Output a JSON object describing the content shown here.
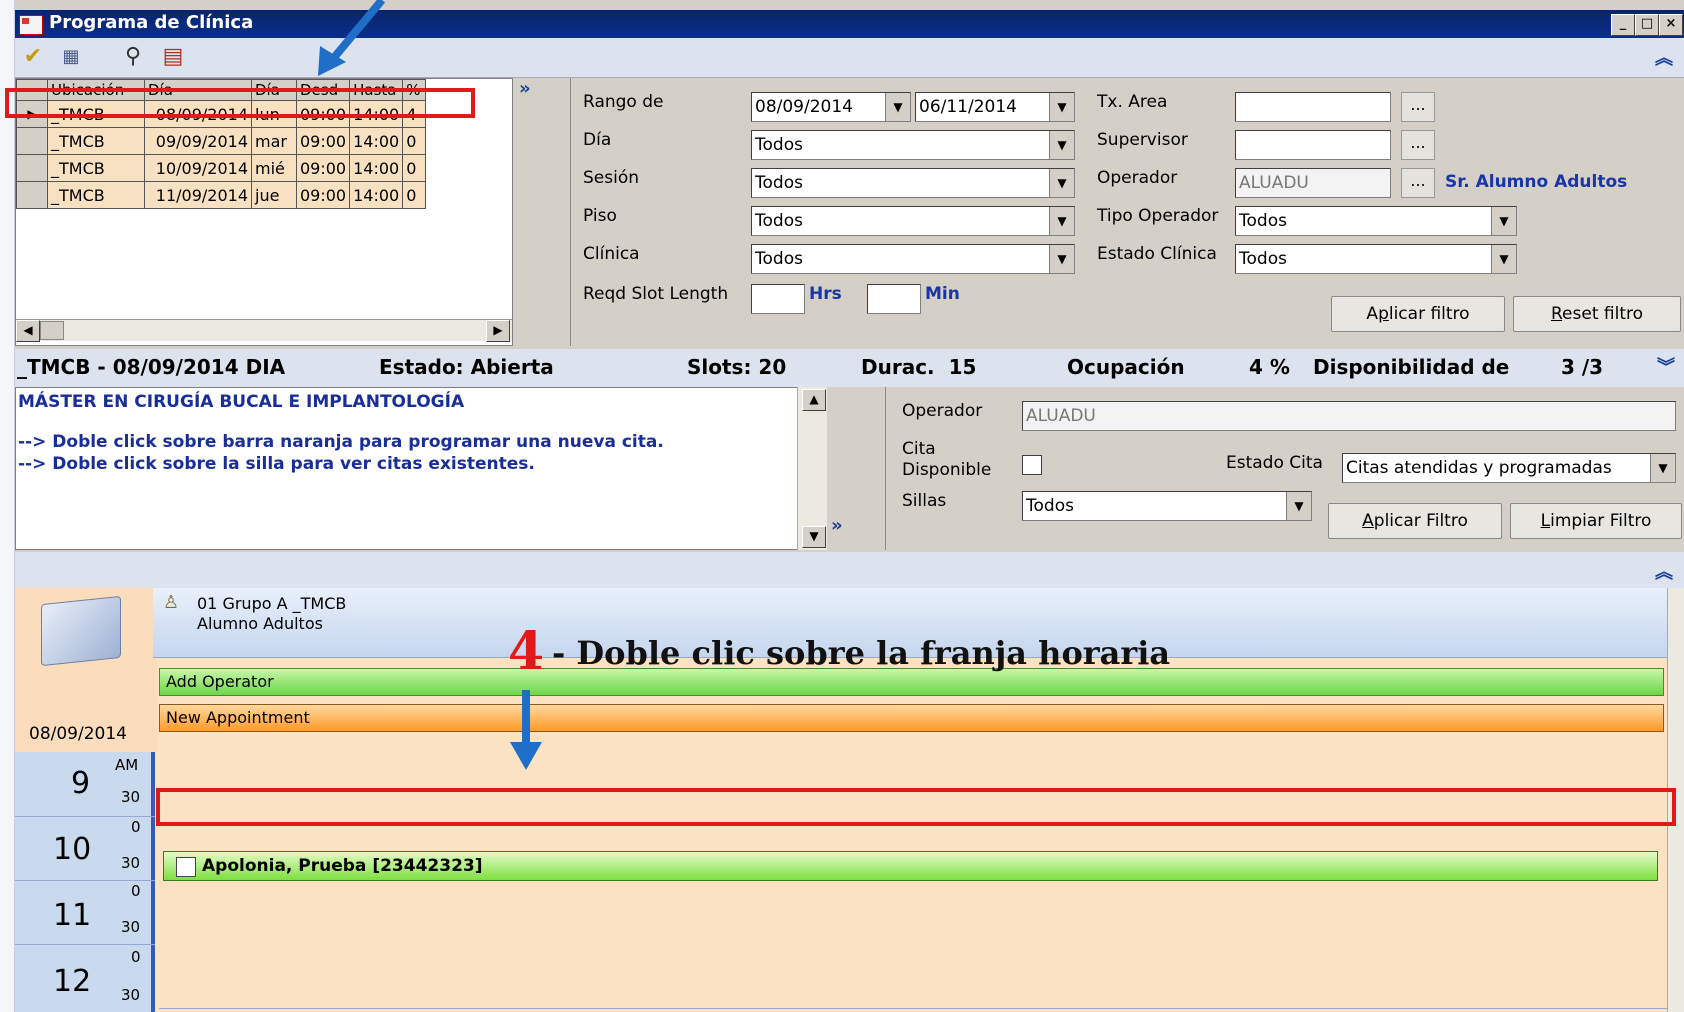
{
  "window": {
    "title": "Programa de Clínica"
  },
  "grid": {
    "headers": [
      "Ubicación",
      "Día",
      "Día",
      "Desd",
      "Hasta",
      "%"
    ],
    "rows": [
      [
        "_TMCB",
        "08/09/2014",
        "lun",
        "09:00",
        "14:00",
        "4"
      ],
      [
        "_TMCB",
        "09/09/2014",
        "mar",
        "09:00",
        "14:00",
        "0"
      ],
      [
        "_TMCB",
        "10/09/2014",
        "mié",
        "09:00",
        "14:00",
        "0"
      ],
      [
        "_TMCB",
        "11/09/2014",
        "jue",
        "09:00",
        "14:00",
        "0"
      ]
    ]
  },
  "filters": {
    "rango_label": "Rango de",
    "rango_from": "08/09/2014",
    "rango_to": "06/11/2014",
    "dia_label": "Día",
    "dia_value": "Todos",
    "sesion_label": "Sesión",
    "sesion_value": "Todos",
    "piso_label": "Piso",
    "piso_value": "Todos",
    "clinica_label": "Clínica",
    "clinica_value": "Todos",
    "slot_label": "Reqd Slot Length",
    "hrs_label": "Hrs",
    "min_label": "Min",
    "txarea_label": "Tx. Area",
    "supervisor_label": "Supervisor",
    "operador_label": "Operador",
    "operador_value": "ALUADU",
    "operador_name": "Sr. Alumno Adultos",
    "tipo_label": "Tipo Operador",
    "tipo_value": "Todos",
    "estado_label": "Estado Clínica",
    "estado_value": "Todos",
    "dots": "...",
    "apply_prefix": "A",
    "apply_u": "p",
    "apply_rest": "licar filtro",
    "reset_u": "R",
    "reset_rest": "eset filtro"
  },
  "status": {
    "session": "_TMCB - 08/09/2014 DIA",
    "estado": "Estado: Abierta",
    "slots": "Slots: 20",
    "durac": "Durac.  15",
    "ocupacion": "Ocupación",
    "pct": "4 %",
    "disponibilidad": "Disponibilidad de",
    "ratio": "3 /3"
  },
  "notes": {
    "title": "MÁSTER EN CIRUGÍA BUCAL E IMPLANTOLOGÍA",
    "line1": "--> Doble click sobre barra naranja para programar una nueva cita.",
    "line2": "--> Doble click sobre la silla para ver citas existentes."
  },
  "cal_filter": {
    "operador_label": "Operador",
    "operador_value": "ALUADU",
    "cita_label1": "Cita",
    "cita_label2": "Disponible",
    "estado_label": "Estado Cita",
    "estado_value": "Citas atendidas y programadas",
    "sillas_label": "Sillas",
    "sillas_value": "Todos",
    "apply_u": "A",
    "apply_rest": "plicar Filtro",
    "clear_u": "L",
    "clear_rest": "impiar Filtro"
  },
  "calendar": {
    "date": "08/09/2014",
    "group_line1": "01 Grupo A _TMCB",
    "group_line2": "Alumno Adultos",
    "add_operator": "Add Operator",
    "new_appointment": "New Appointment",
    "am": "AM",
    "hours": [
      "9",
      "10",
      "11",
      "12"
    ],
    "min30": "30",
    "min0": "0",
    "appointment": "Apolonia, Prueba [23442323]"
  },
  "annotation": {
    "step": "4",
    "text": "- Doble clic sobre la franja horaria"
  },
  "colors": {
    "red_highlight": "#e0191b",
    "annotation_arrow": "#1f6fc8",
    "step_number": "#e0191b"
  }
}
